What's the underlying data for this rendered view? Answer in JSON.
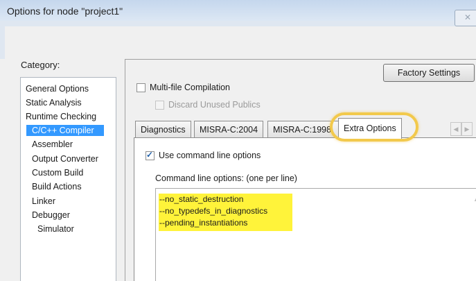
{
  "window": {
    "title": "Options for node \"project1\"",
    "close_icon": "close-icon"
  },
  "category": {
    "label": "Category:",
    "items": [
      {
        "label": "General Options"
      },
      {
        "label": "Static Analysis"
      },
      {
        "label": "Runtime Checking"
      },
      {
        "label": "C/C++ Compiler",
        "selected": true
      },
      {
        "label": "Assembler"
      },
      {
        "label": "Output Converter"
      },
      {
        "label": "Custom Build"
      },
      {
        "label": "Build Actions"
      },
      {
        "label": "Linker"
      },
      {
        "label": "Debugger"
      },
      {
        "label": "Simulator"
      }
    ]
  },
  "factory_settings_label": "Factory Settings",
  "multifile": {
    "label": "Multi-file Compilation",
    "checked": false
  },
  "discard": {
    "label": "Discard Unused Publics",
    "checked": false,
    "disabled": true
  },
  "tabs": [
    {
      "label": "Diagnostics"
    },
    {
      "label": "MISRA-C:2004"
    },
    {
      "label": "MISRA-C:1998"
    },
    {
      "label": "Extra Options",
      "active": true
    }
  ],
  "use_cmdline": {
    "label": "Use command line options",
    "checked": true
  },
  "cmdline_label": "Command line options:  (one per line)",
  "cmdline_lines": [
    "--no_static_destruction",
    "--no_typedefs_in_diagnostics",
    "--pending_instantiations"
  ],
  "colors": {
    "selection": "#3399ff",
    "highlight_ring": "#f2c94c",
    "text_highlight": "#fff33a"
  }
}
